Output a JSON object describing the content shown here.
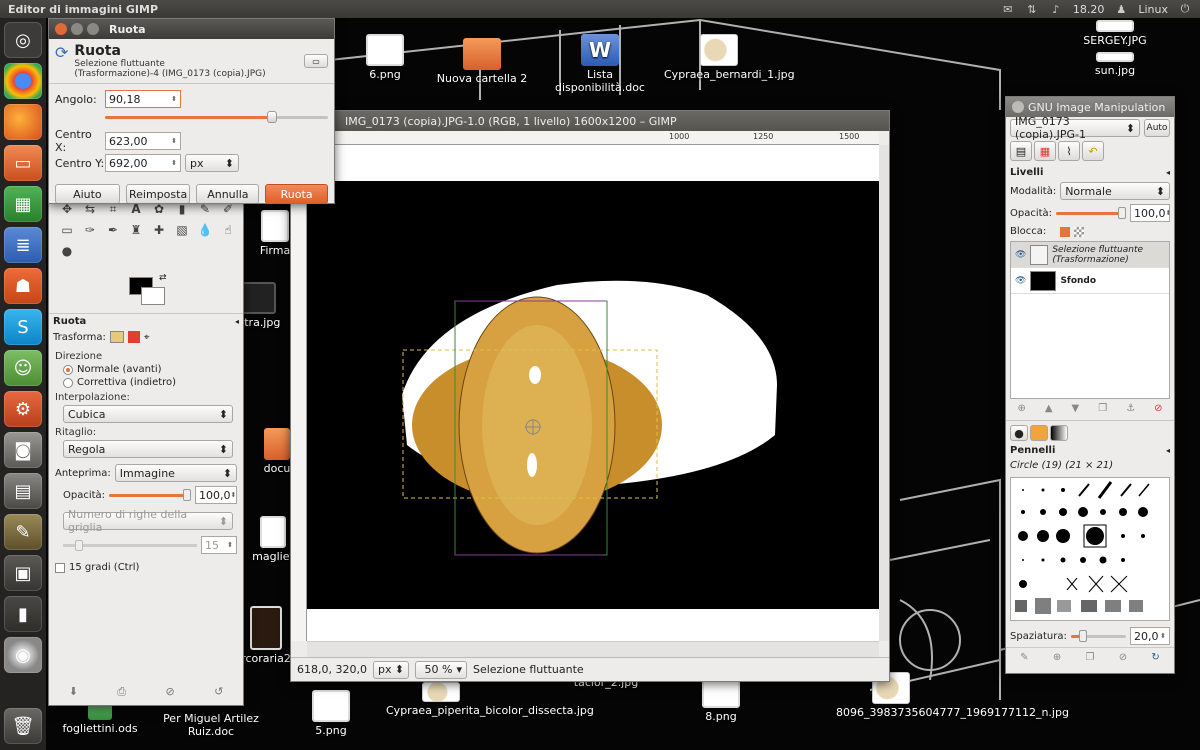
{
  "topbar": {
    "title": "Editor di immagini GIMP",
    "time": "18.20",
    "user": "Linux"
  },
  "desktop_icons": [
    {
      "label": "6.png",
      "type": "thumb"
    },
    {
      "label": "Nuova cartella 2",
      "type": "folder"
    },
    {
      "label": "Lista disponibilità.doc",
      "type": "doc"
    },
    {
      "label": "Cypraea_bernardi_1.jpg",
      "type": "shell"
    },
    {
      "label": "SERGEY.JPG",
      "type": "thumb"
    },
    {
      "label": "sun.jpg",
      "type": "thumb"
    },
    {
      "label": "fogliettini.ods",
      "type": "doc"
    },
    {
      "label": "Per Miguel Artilez Ruiz.doc",
      "type": "doc"
    },
    {
      "label": "5.png",
      "type": "thumb"
    },
    {
      "label": "Cypraea_piperita_bicolor_dissecta.jpg",
      "type": "shell"
    },
    {
      "label": "8.png",
      "type": "thumb"
    },
    {
      "label": "8096_3983735604777_1969177112_n.jpg",
      "type": "shell"
    },
    {
      "label": "Altra.jpg",
      "type": "thumb"
    },
    {
      "label": "Firma",
      "type": "thumb"
    },
    {
      "label": "docu",
      "type": "folder"
    },
    {
      "label": "magliet",
      "type": "thumb"
    },
    {
      "label": "rcoraria2",
      "type": "thumb"
    },
    {
      "label": "tacior_2.jpg",
      "type": "thumb"
    }
  ],
  "rotate_dialog": {
    "window_title": "Ruota",
    "heading": "Ruota",
    "subtitle_line1": "Selezione fluttuante",
    "subtitle_line2": "(Trasformazione)-4 (IMG_0173 (copia).JPG)",
    "angle_label": "Angolo:",
    "angle_value": "90,18",
    "angle_fraction": 0.75,
    "center_x_label": "Centro X:",
    "center_x_value": "623,00",
    "center_y_label": "Centro Y:",
    "center_y_value": "692,00",
    "unit": "px",
    "buttons": {
      "help": "Aiuto",
      "reset": "Reimposta",
      "cancel": "Annulla",
      "rotate": "Ruota"
    }
  },
  "toolbox": {
    "options_title": "Ruota",
    "transform_label": "Trasforma:",
    "direction_label": "Direzione",
    "direction_forward": "Normale (avanti)",
    "direction_backward": "Correttiva (indietro)",
    "interpolation_label": "Interpolazione:",
    "interpolation_value": "Cubica",
    "clipping_label": "Ritaglio:",
    "clipping_value": "Regola",
    "preview_label": "Anteprima:",
    "preview_value": "Immagine",
    "opacity_label": "Opacità:",
    "opacity_value": "100,0",
    "grid_lines_value": "Numero di righe della griglia",
    "grid_count": "15",
    "constrain_label": "15 gradi  (Ctrl)"
  },
  "image_window": {
    "title": "IMG_0173 (copia).JPG-1.0 (RGB, 1 livello) 1600x1200 – GIMP",
    "ruler_ticks": [
      "1000",
      "1250",
      "1500"
    ],
    "coords": "618,0, 320,0",
    "unit": "px",
    "zoom": "50 %",
    "status": "Selezione fluttuante"
  },
  "layers_dock": {
    "window_title": "GNU Image Manipulation",
    "image_selector": "IMG_0173 (copia).JPG-1",
    "auto_button": "Auto",
    "panel_title": "Livelli",
    "mode_label": "Modalità:",
    "mode_value": "Normale",
    "opacity_label": "Opacità:",
    "opacity_value": "100,0",
    "lock_label": "Blocca:",
    "layers": [
      {
        "name": "Selezione fluttuante (Trasformazione)",
        "selected": true
      },
      {
        "name": "Sfondo",
        "selected": false
      }
    ],
    "brushes_title": "Pennelli",
    "brush_name": "Circle (19) (21 × 21)",
    "spacing_label": "Spaziatura:",
    "spacing_value": "20,0"
  }
}
